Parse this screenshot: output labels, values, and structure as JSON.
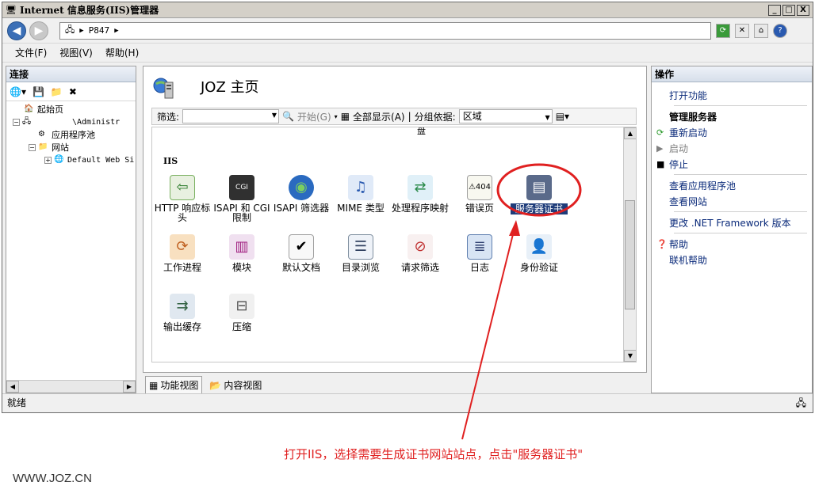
{
  "window": {
    "title": "Internet 信息服务(IIS)管理器",
    "controls": [
      "_",
      "□",
      "X"
    ]
  },
  "address": {
    "path": "P847",
    "help_icon": "?"
  },
  "menu": {
    "file": "文件(F)",
    "view": "视图(V)",
    "help": "帮助(H)"
  },
  "connections": {
    "title": "连接",
    "tree": {
      "start_page": "起始页",
      "server": "\\Administr",
      "app_pools": "应用程序池",
      "sites": "网站",
      "default_site": "Default Web Si"
    }
  },
  "center": {
    "title": "JOZ 主页",
    "filter_label": "筛选:",
    "start_label": "开始(G)",
    "show_all_label": "全部显示(A)",
    "group_by_label": "分组依据:",
    "group_by_value": "区域",
    "cut_label": "盘",
    "section_label": "IIS",
    "features": [
      {
        "label": "HTTP 响应标头",
        "icon": "http-response-headers-icon"
      },
      {
        "label": "ISAPI 和 CGI 限制",
        "icon": "isapi-cgi-icon"
      },
      {
        "label": "ISAPI 筛选器",
        "icon": "isapi-filters-icon"
      },
      {
        "label": "MIME 类型",
        "icon": "mime-types-icon"
      },
      {
        "label": "处理程序映射",
        "icon": "handler-mappings-icon"
      },
      {
        "label": "错误页",
        "icon": "error-pages-icon"
      },
      {
        "label": "服务器证书",
        "icon": "server-certificates-icon",
        "selected": true
      },
      {
        "label": "工作进程",
        "icon": "worker-processes-icon"
      },
      {
        "label": "模块",
        "icon": "modules-icon"
      },
      {
        "label": "默认文档",
        "icon": "default-document-icon"
      },
      {
        "label": "目录浏览",
        "icon": "directory-browsing-icon"
      },
      {
        "label": "请求筛选",
        "icon": "request-filtering-icon"
      },
      {
        "label": "日志",
        "icon": "logging-icon"
      },
      {
        "label": "身份验证",
        "icon": "authentication-icon"
      },
      {
        "label": "输出缓存",
        "icon": "output-caching-icon"
      },
      {
        "label": "压缩",
        "icon": "compression-icon"
      }
    ]
  },
  "views": {
    "features_view": "功能视图",
    "content_view": "内容视图"
  },
  "actions": {
    "title": "操作",
    "open_feature": "打开功能",
    "manage_server": "管理服务器",
    "restart": "重新启动",
    "start": "启动",
    "stop": "停止",
    "view_app_pools": "查看应用程序池",
    "view_sites": "查看网站",
    "change_framework": "更改 .NET Framework 版本",
    "help": "帮助",
    "online_help": "联机帮助"
  },
  "status": {
    "text": "就绪"
  },
  "annotation": {
    "text": "打开IIS，选择需要生成证书网站站点，点击\"服务器证书\"",
    "color": "#e02020"
  },
  "watermark": "WWW.JOZ.CN"
}
